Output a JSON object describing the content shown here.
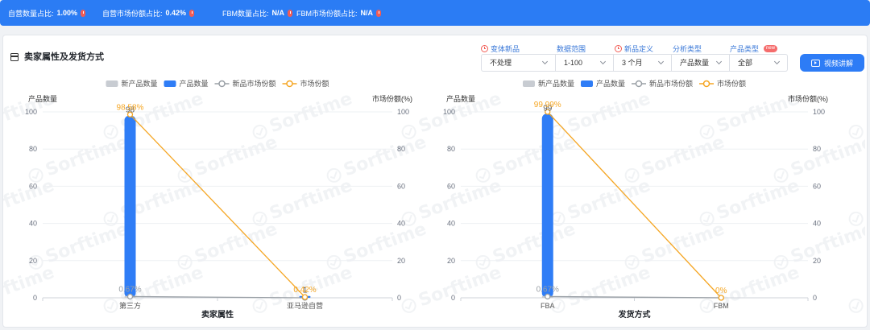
{
  "top_bar": {
    "stats": [
      {
        "label": "自营数量占比:",
        "value": "1.00%"
      },
      {
        "label": "自营市场份额占比:",
        "value": "0.42%"
      },
      {
        "label": "FBM数量占比:",
        "value": "N/A"
      },
      {
        "label": "FBM市场份额占比:",
        "value": "N/A"
      }
    ],
    "stat_icon": "alert-icon"
  },
  "section": {
    "title": "卖家属性及发货方式",
    "icon": "table-icon"
  },
  "filters": [
    {
      "label": "变体新品",
      "value": "不处理",
      "icon": "clock-icon"
    },
    {
      "label": "数据范围",
      "value": "1-100"
    },
    {
      "label": "新品定义",
      "value": "3 个月",
      "icon": "clock-icon"
    },
    {
      "label": "分析类型",
      "value": "产品数量"
    },
    {
      "label": "产品类型",
      "value": "全部",
      "badge": "new"
    }
  ],
  "video_button": {
    "label": "视频讲解",
    "icon": "play-icon"
  },
  "watermark": "Sorftime",
  "colors": {
    "header_bar": "#2b7cf4",
    "primary": "#2d7cf6",
    "alert": "#f25c54",
    "badge": "#f56c6c",
    "filter_label": "#3a78d8"
  },
  "chart_data": [
    {
      "type": "bar",
      "categories": [
        "第三方",
        "亚马逊自营"
      ],
      "xlabel": "卖家属性",
      "ylabel": "产品数量",
      "y2label": "市场份额(%)",
      "ylim": [
        0,
        100
      ],
      "y2lim": [
        0,
        100
      ],
      "yticks": [
        0,
        20,
        40,
        60,
        80,
        100
      ],
      "y2ticks": [
        0,
        20,
        40,
        60,
        80,
        100
      ],
      "grid": true,
      "legend_position": "top",
      "series": [
        {
          "name": "新产品数量",
          "type": "bar",
          "axis": "left",
          "values": [
            1,
            0
          ],
          "color": "#c8ccd2"
        },
        {
          "name": "产品数量",
          "type": "bar",
          "axis": "left",
          "values": [
            98,
            1
          ],
          "labels": [
            "98",
            "1"
          ],
          "color": "#2f7df6"
        },
        {
          "name": "新品市场份额",
          "type": "line",
          "axis": "right",
          "values": [
            0.67,
            0
          ],
          "labels": [
            "0.67%",
            null
          ],
          "color": "#9aa0a6"
        },
        {
          "name": "市场份额",
          "type": "line",
          "axis": "right",
          "values": [
            98.58,
            0.42
          ],
          "labels": [
            "98.58%",
            "0.42%"
          ],
          "color": "#f5a623"
        }
      ]
    },
    {
      "type": "bar",
      "categories": [
        "FBA",
        "FBM"
      ],
      "xlabel": "发货方式",
      "ylabel": "产品数量",
      "y2label": "市场份额(%)",
      "ylim": [
        0,
        100
      ],
      "y2lim": [
        0,
        100
      ],
      "yticks": [
        0,
        20,
        40,
        60,
        80,
        100
      ],
      "y2ticks": [
        0,
        20,
        40,
        60,
        80,
        100
      ],
      "grid": true,
      "legend_position": "top",
      "series": [
        {
          "name": "新产品数量",
          "type": "bar",
          "axis": "left",
          "values": [
            1,
            0
          ],
          "color": "#c8ccd2"
        },
        {
          "name": "产品数量",
          "type": "bar",
          "axis": "left",
          "values": [
            99,
            0
          ],
          "labels": [
            "99",
            null
          ],
          "color": "#2f7df6"
        },
        {
          "name": "新品市场份额",
          "type": "line",
          "axis": "right",
          "values": [
            0.67,
            0
          ],
          "labels": [
            "0.67%",
            null
          ],
          "color": "#9aa0a6"
        },
        {
          "name": "市场份额",
          "type": "line",
          "axis": "right",
          "values": [
            99.99,
            0
          ],
          "labels": [
            "99.99%",
            "0%"
          ],
          "color": "#f5a623"
        }
      ]
    }
  ]
}
